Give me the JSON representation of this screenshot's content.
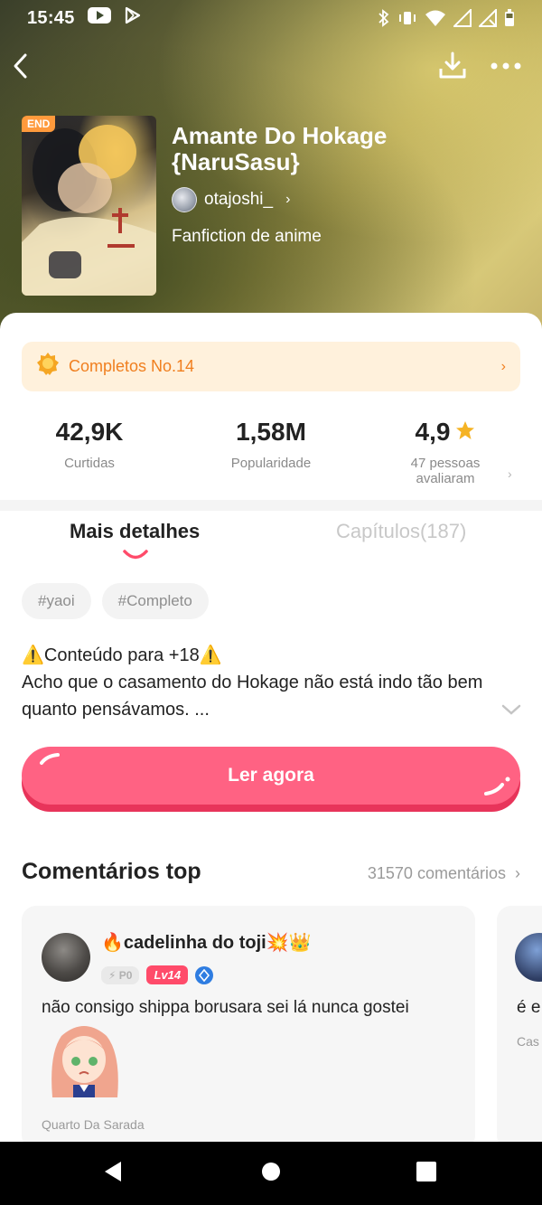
{
  "status_bar": {
    "time": "15:45",
    "icons": [
      "youtube-icon",
      "play-store-icon",
      "bluetooth-icon",
      "vibrate-icon",
      "wifi-icon",
      "signal-icon",
      "signal-icon",
      "battery-icon"
    ]
  },
  "header": {
    "back_icon": "back-arrow-icon",
    "download_icon": "download-icon",
    "more_icon": "more-dots-icon"
  },
  "book": {
    "cover_badge": "END",
    "title": "Amante Do Hokage {NaruSasu}",
    "author": "otajoshi_",
    "author_chevron": "›",
    "genre": "Fanfiction de anime"
  },
  "rank": {
    "label": "Completos No.14",
    "chevron": "›"
  },
  "stats": {
    "likes_value": "42,9K",
    "likes_label": "Curtidas",
    "popularity_value": "1,58M",
    "popularity_label": "Popularidade",
    "rating_value": "4,9",
    "rating_label": "47 pessoas avaliaram",
    "chevron": "›"
  },
  "tabs": {
    "details": "Mais detalhes",
    "chapters": "Capítulos(187)"
  },
  "tags": [
    "#yaoi",
    "#Completo"
  ],
  "description": {
    "warning": "⚠️Conteúdo para +18⚠️",
    "text": "Acho que o casamento do Hokage não está indo tão bem quanto pensávamos. ..."
  },
  "read_button": {
    "label": "Ler agora"
  },
  "comments": {
    "title": "Comentários top",
    "count": "31570 comentários",
    "chevron": "›",
    "items": [
      {
        "user": "🔥cadelinha do toji💥👑",
        "badge_p": "P0",
        "badge_lv": "Lv14",
        "text": "não consigo shippa borusara sei lá nunca gostei",
        "book": "Quarto Da Sarada"
      },
      {
        "text": "é e",
        "book": "Cas"
      }
    ]
  },
  "colors": {
    "accent": "#ff4b6a",
    "rank_text": "#f07f1f",
    "rank_bg": "#fff1dc",
    "star": "#f5b324"
  }
}
